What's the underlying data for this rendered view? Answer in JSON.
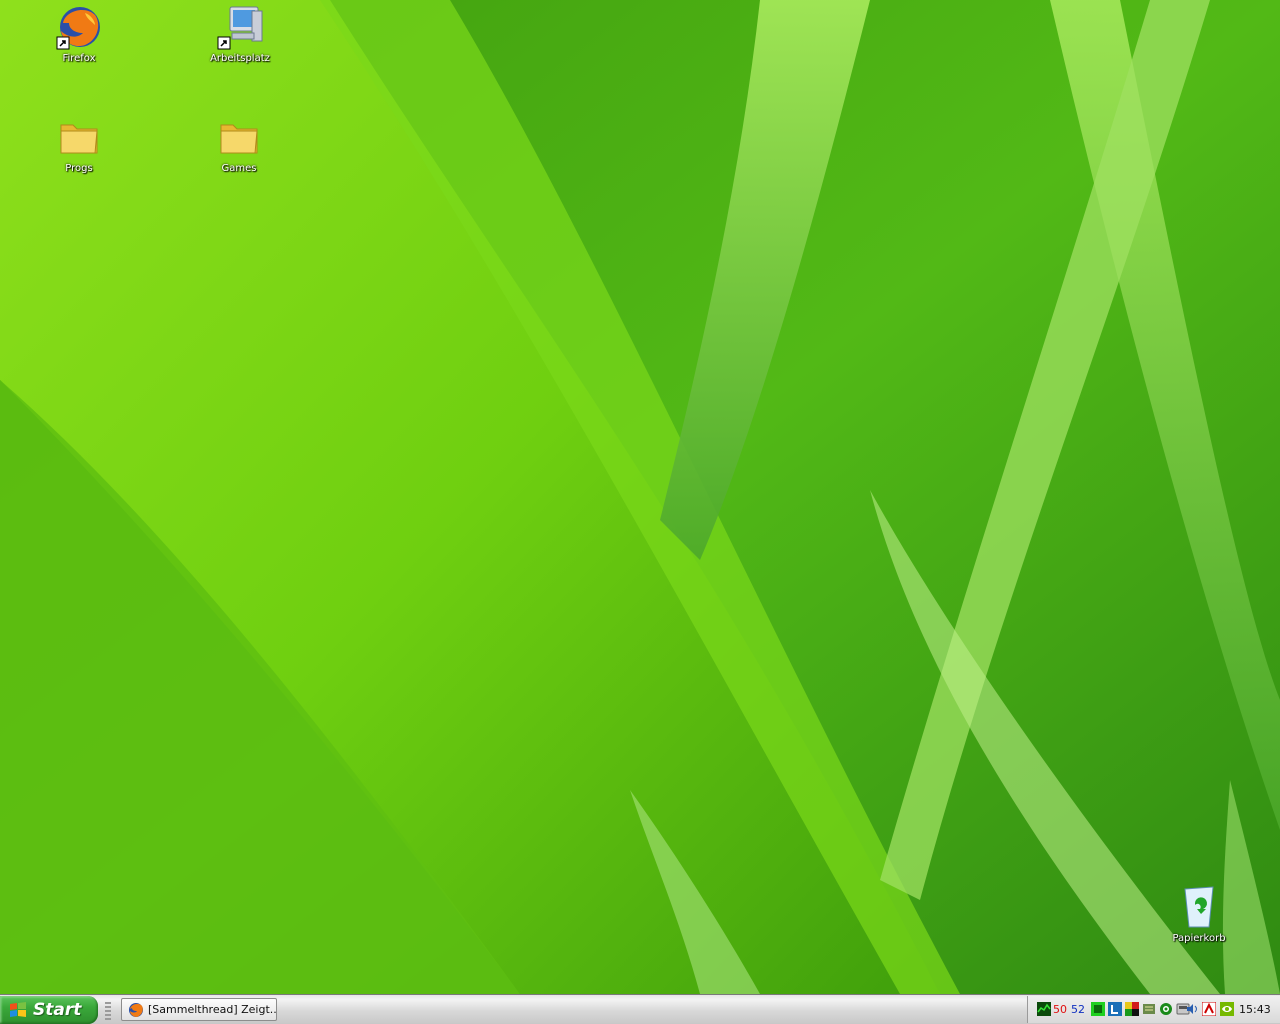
{
  "desktop": {
    "icons": [
      {
        "label": "Firefox",
        "icon": "firefox-icon"
      },
      {
        "label": "Arbeitsplatz",
        "icon": "my-computer-icon"
      },
      {
        "label": "Progs",
        "icon": "folder-icon"
      },
      {
        "label": "Games",
        "icon": "folder-icon"
      },
      {
        "label": "Papierkorb",
        "icon": "recycle-bin-icon"
      }
    ]
  },
  "taskbar": {
    "start_label": "Start",
    "window_button_label": "[Sammelthread] Zeigt...",
    "tray": {
      "value_red": "50",
      "value_blue": "52",
      "clock": "15:43"
    }
  },
  "colors": {
    "start_green": "#3aa83a",
    "tray_red": "#e01010",
    "tray_blue": "#1030c0"
  }
}
